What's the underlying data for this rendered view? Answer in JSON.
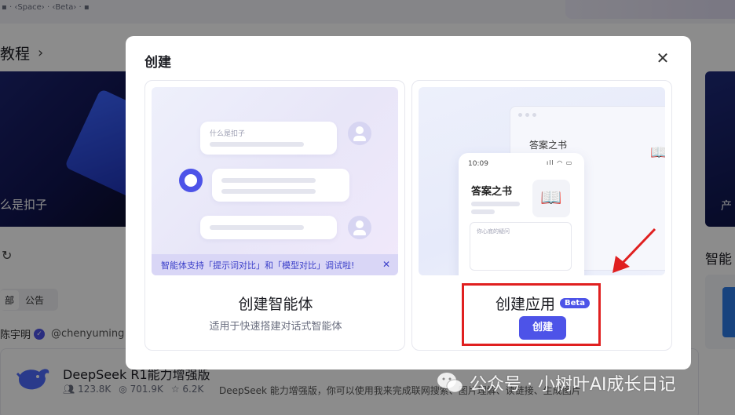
{
  "background": {
    "top_strip_text": "▪ · ‹Space› · ‹Beta› · ▪",
    "heading": "教程",
    "heading_chevron": "›",
    "banner_left_text": "么是扣子",
    "banner_right_text": "产",
    "refresh_icon": "↻",
    "side_heading": "智能",
    "tabs": [
      "部",
      "公告"
    ],
    "author_name": "陈宇明",
    "author_handle": "@chenyuming",
    "card": {
      "title": "DeepSeek R1能力增强版",
      "stats": [
        "123.8K",
        "701.9K",
        "6.2K"
      ],
      "description": "DeepSeek 能力增强版，你可以使用我来完成联网搜索、图片理解、读链接、生成图片"
    }
  },
  "modal": {
    "title": "创建",
    "close_icon": "✕",
    "agent_option": {
      "chat_placeholder": "什么是扣子",
      "notice": "智能体支持「提示词对比」和「模型对比」调试啦!",
      "notice_close": "✕",
      "title": "创建智能体",
      "subtitle": "适用于快速搭建对话式智能体"
    },
    "app_option": {
      "window_title": "答案之书",
      "phone_time": "10:09",
      "phone_status": "ıll ◠ ▭",
      "phone_title": "答案之书",
      "phone_input_placeholder": "你心底的疑问",
      "book_icon": "📖",
      "title": "创建应用",
      "badge": "Beta",
      "button": "创建"
    }
  },
  "watermark": "公众号 · 小树叶AI成长日记",
  "colors": {
    "accent": "#4d53e8",
    "annotation": "#e02020"
  }
}
